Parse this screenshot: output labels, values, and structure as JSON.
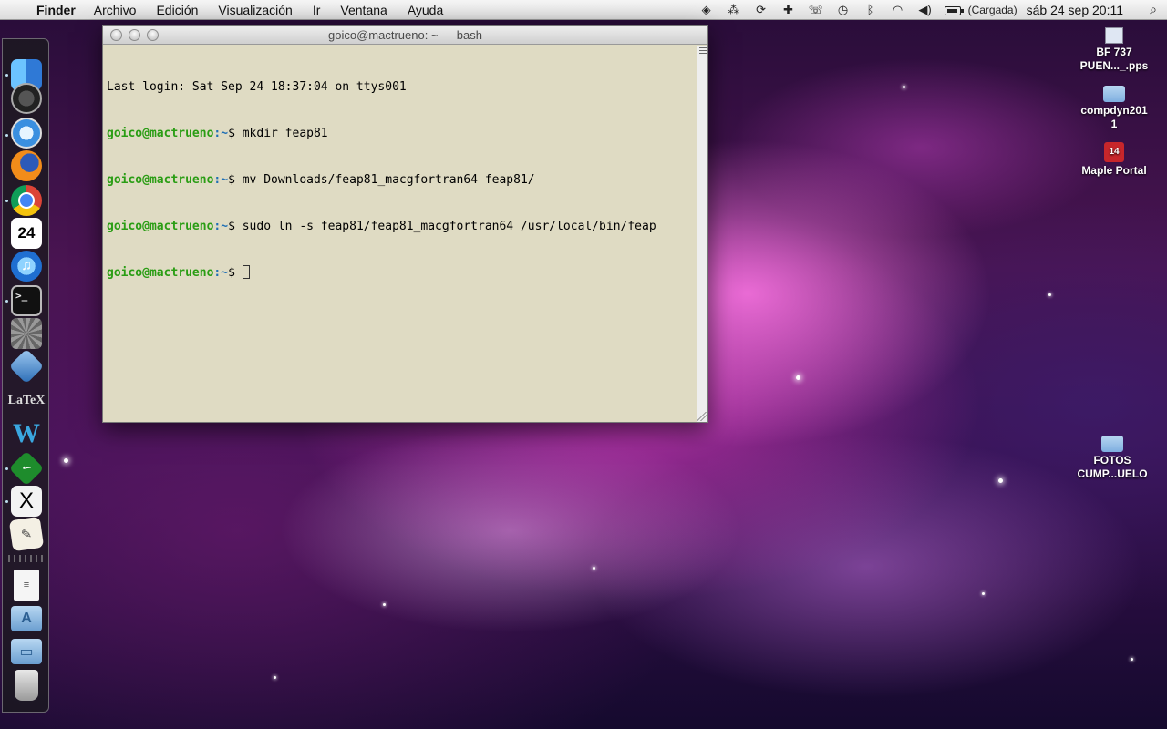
{
  "menubar": {
    "app": "Finder",
    "items": [
      "Archivo",
      "Edición",
      "Visualización",
      "Ir",
      "Ventana",
      "Ayuda"
    ],
    "battery_status": "(Cargada)",
    "clock": "sáb 24 sep  20:11"
  },
  "terminal": {
    "title": "goico@mactrueno: ~ — bash",
    "last_login": "Last login: Sat Sep 24 18:37:04 on ttys001",
    "prompt_user": "goico@mactrueno",
    "prompt_path": ":~",
    "prompt_symbol": "$ ",
    "commands": [
      "mkdir feap81",
      "mv Downloads/feap81_macgfortran64 feap81/",
      "sudo ln -s feap81/feap81_macgfortran64 /usr/local/bin/feap",
      ""
    ]
  },
  "dock": {
    "ical_day": "24",
    "terminal_glyph": ">_",
    "latex_label": "LaTeX",
    "word_label": "W",
    "x11_label": "X"
  },
  "desktop_icons": [
    {
      "line1": "BF 737",
      "line2": "PUEN..._.pps"
    },
    {
      "line1": "compdyn201",
      "line2": "1"
    },
    {
      "line1": "Maple Portal",
      "badge": "14"
    },
    {
      "line1": "FOTOS",
      "line2": "CUMP...UELO"
    }
  ],
  "colors": {
    "prompt_user": "#2a9d14",
    "prompt_path": "#1f6fb5",
    "terminal_bg": "#dfdbc3"
  }
}
